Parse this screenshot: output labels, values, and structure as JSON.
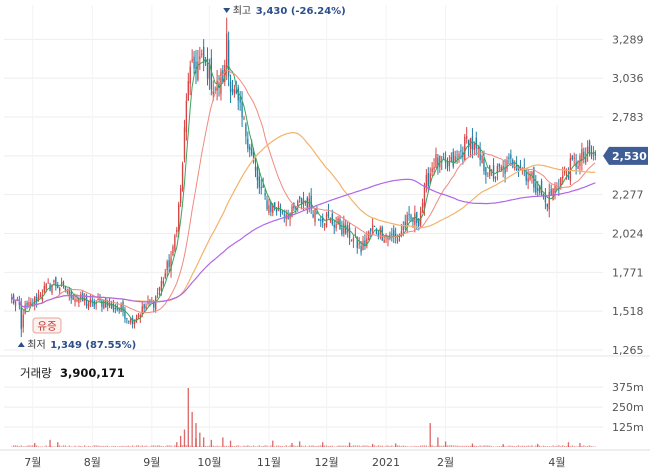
{
  "chart_data": {
    "type": "candlestick",
    "colors": {
      "up": "#d64545",
      "down": "#1f7fa8",
      "ma_short": "#3aa35a",
      "ma_mid": "#f08a80",
      "ma_long": "#f2b36b",
      "ma_longest": "#b168e6",
      "badge": "#3f5e96",
      "annotation": "#2c4f8c",
      "grid": "#eeeeee",
      "volume": "#d64545"
    },
    "y_axis": {
      "ticks": [
        {
          "value": 3289,
          "label": "3,289"
        },
        {
          "value": 3036,
          "label": "3,036"
        },
        {
          "value": 2783,
          "label": "2,783"
        },
        {
          "value": 2530,
          "label": "2,530"
        },
        {
          "value": 2277,
          "label": "2,277"
        },
        {
          "value": 2024,
          "label": "2,024"
        },
        {
          "value": 1771,
          "label": "1,771"
        },
        {
          "value": 1518,
          "label": "1,518"
        },
        {
          "value": 1265,
          "label": "1,265"
        }
      ],
      "range": [
        1265,
        3480
      ]
    },
    "x_axis": {
      "labels": [
        {
          "label": "7월",
          "day": 11
        },
        {
          "label": "8월",
          "day": 42
        },
        {
          "label": "9월",
          "day": 73
        },
        {
          "label": "10월",
          "day": 103
        },
        {
          "label": "11월",
          "day": 134
        },
        {
          "label": "12월",
          "day": 164
        },
        {
          "label": "2021",
          "day": 195
        },
        {
          "label": "2월",
          "day": 226
        },
        {
          "label": "4월",
          "day": 284
        }
      ],
      "range": [
        -4,
        308
      ]
    },
    "annotations": {
      "high": {
        "text": "최고",
        "value": "3,430 (-26.24%)",
        "price": 3430,
        "day": 112
      },
      "low": {
        "text": "최저",
        "value": "1,349 (87.55%)",
        "price": 1349,
        "day": 5
      },
      "event_tag": "유증",
      "last_price_label": "2,530",
      "last_price": 2530
    },
    "volume": {
      "title": "거래량",
      "value": "3,900,171",
      "ticks": [
        {
          "value": 375,
          "label": "375m"
        },
        {
          "value": 250,
          "label": "250m"
        },
        {
          "value": 125,
          "label": "125m"
        }
      ],
      "range": [
        0,
        420
      ]
    },
    "price_waypoints": [
      [
        0,
        1600
      ],
      [
        6,
        1520
      ],
      [
        10,
        1560
      ],
      [
        16,
        1650
      ],
      [
        22,
        1700
      ],
      [
        28,
        1660
      ],
      [
        34,
        1600
      ],
      [
        42,
        1560
      ],
      [
        48,
        1580
      ],
      [
        54,
        1540
      ],
      [
        58,
        1520
      ],
      [
        62,
        1460
      ],
      [
        66,
        1500
      ],
      [
        70,
        1550
      ],
      [
        74,
        1580
      ],
      [
        78,
        1700
      ],
      [
        84,
        1900
      ],
      [
        88,
        2300
      ],
      [
        92,
        3050
      ],
      [
        98,
        3150
      ],
      [
        102,
        3100
      ],
      [
        106,
        2950
      ],
      [
        112,
        3100
      ],
      [
        118,
        2850
      ],
      [
        124,
        2600
      ],
      [
        128,
        2350
      ],
      [
        134,
        2200
      ],
      [
        140,
        2180
      ],
      [
        146,
        2150
      ],
      [
        152,
        2250
      ],
      [
        158,
        2170
      ],
      [
        164,
        2120
      ],
      [
        170,
        2080
      ],
      [
        176,
        2020
      ],
      [
        182,
        1920
      ],
      [
        188,
        2060
      ],
      [
        194,
        2020
      ],
      [
        200,
        1990
      ],
      [
        206,
        2100
      ],
      [
        212,
        2120
      ],
      [
        216,
        2350
      ],
      [
        220,
        2500
      ],
      [
        226,
        2450
      ],
      [
        232,
        2500
      ],
      [
        238,
        2650
      ],
      [
        244,
        2500
      ],
      [
        250,
        2400
      ],
      [
        256,
        2440
      ],
      [
        262,
        2500
      ],
      [
        268,
        2420
      ],
      [
        274,
        2330
      ],
      [
        278,
        2220
      ],
      [
        282,
        2300
      ],
      [
        286,
        2380
      ],
      [
        292,
        2470
      ],
      [
        298,
        2530
      ],
      [
        304,
        2530
      ]
    ],
    "volume_spikes": [
      [
        88,
        70
      ],
      [
        90,
        110
      ],
      [
        92,
        370
      ],
      [
        94,
        220
      ],
      [
        96,
        150
      ],
      [
        98,
        90
      ],
      [
        100,
        60
      ],
      [
        104,
        45
      ],
      [
        110,
        60
      ],
      [
        114,
        40
      ],
      [
        96,
        55
      ],
      [
        86,
        30
      ],
      [
        20,
        45
      ],
      [
        24,
        30
      ],
      [
        12,
        25
      ],
      [
        162,
        30
      ],
      [
        176,
        28
      ],
      [
        218,
        150
      ],
      [
        222,
        60
      ],
      [
        226,
        35
      ],
      [
        290,
        30
      ],
      [
        296,
        25
      ],
      [
        136,
        40
      ],
      [
        146,
        25
      ],
      [
        150,
        35
      ],
      [
        188,
        20
      ],
      [
        200,
        22
      ],
      [
        240,
        22
      ],
      [
        256,
        18
      ],
      [
        274,
        20
      ]
    ]
  }
}
